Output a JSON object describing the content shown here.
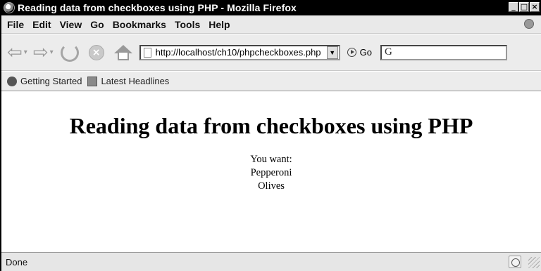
{
  "window": {
    "title": "Reading data from checkboxes using PHP - Mozilla Firefox",
    "controls": {
      "minimize": "_",
      "maximize": "□",
      "close": "×"
    }
  },
  "menubar": {
    "items": [
      {
        "label": "File"
      },
      {
        "label": "Edit"
      },
      {
        "label": "View"
      },
      {
        "label": "Go"
      },
      {
        "label": "Bookmarks"
      },
      {
        "label": "Tools"
      },
      {
        "label": "Help"
      }
    ]
  },
  "navbar": {
    "back_icon": "back-arrow-icon",
    "forward_icon": "forward-arrow-icon",
    "reload_icon": "reload-icon",
    "stop_icon": "stop-icon",
    "home_icon": "home-icon",
    "url": "http://localhost/ch10/phpcheckboxes.php",
    "go_label": "Go",
    "search_placeholder": ""
  },
  "bookmarks": {
    "items": [
      {
        "label": "Getting Started",
        "icon": "firefox-icon"
      },
      {
        "label": "Latest Headlines",
        "icon": "rss-icon"
      }
    ]
  },
  "page": {
    "heading": "Reading data from checkboxes using PHP",
    "intro": "You want:",
    "items": [
      "Pepperoni",
      "Olives"
    ]
  },
  "statusbar": {
    "text": "Done"
  },
  "colors": {
    "titlebar": "#000000",
    "toolbar": "#ececec",
    "page_bg": "#ffffff"
  }
}
